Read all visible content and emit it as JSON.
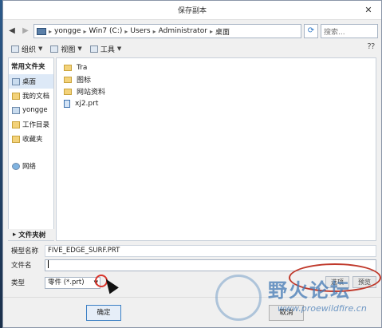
{
  "dialog": {
    "title": "保存副本",
    "close_glyph": "✕"
  },
  "address": {
    "back_glyph": "◀",
    "forward_glyph": "▶",
    "crumbs": [
      "yongge",
      "Win7 (C:)",
      "Users",
      "Administrator",
      "桌面"
    ],
    "separator": "▸",
    "refresh_glyph": "⟳",
    "search_placeholder": "搜索..."
  },
  "toolbar": {
    "organize": "组织",
    "views": "视图",
    "tools": "工具",
    "help_glyph": "⁇"
  },
  "sidebar": {
    "header": "常用文件夹",
    "items": [
      {
        "label": "桌面",
        "icon": "desktop-icon"
      },
      {
        "label": "我的文档",
        "icon": "documents-icon"
      },
      {
        "label": "yongge",
        "icon": "computer-icon"
      },
      {
        "label": "工作目录",
        "icon": "working-dir-icon"
      },
      {
        "label": "收藏夹",
        "icon": "favorites-icon"
      }
    ],
    "network": {
      "label": "网络",
      "icon": "network-icon"
    },
    "folder_tree": "文件夹树"
  },
  "files": [
    {
      "name": "Tra",
      "type": "folder"
    },
    {
      "name": "图标",
      "type": "folder"
    },
    {
      "name": "网站资料",
      "type": "folder"
    },
    {
      "name": "xj2.prt",
      "type": "prt"
    }
  ],
  "form": {
    "model_name_label": "模型名称",
    "model_name_value": "FIVE_EDGE_SURF.PRT",
    "file_name_label": "文件名",
    "file_name_value": "",
    "type_label": "类型",
    "type_value": "零件 (*.prt)",
    "options_label": "选项",
    "preview_label": "预览"
  },
  "buttons": {
    "ok": "确定",
    "cancel": "取消"
  },
  "watermark": {
    "text": "野火论坛",
    "url": "www.proewildfire.cn"
  },
  "colors": {
    "accent": "#3c7fc4",
    "annotation": "#c0392b"
  }
}
